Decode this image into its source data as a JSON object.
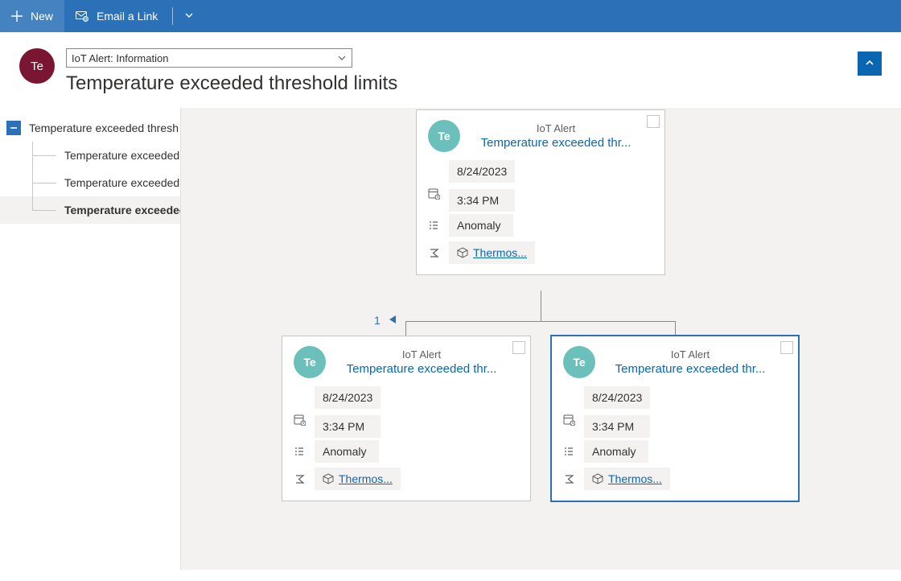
{
  "cmdbar": {
    "new_label": "New",
    "email_label": "Email a Link"
  },
  "header": {
    "avatar_initials": "Te",
    "form_selector": "IoT Alert: Information",
    "title": "Temperature exceeded threshold limits"
  },
  "tree": {
    "root": "Temperature exceeded thresh",
    "children": [
      "Temperature exceeded",
      "Temperature exceeded",
      "Temperature exceeded"
    ],
    "selected_index": 2
  },
  "pager": {
    "count": "1"
  },
  "card_common": {
    "avatar_initials": "Te",
    "type_label": "IoT Alert",
    "title": "Temperature exceeded thr...",
    "date": "8/24/2023",
    "time": "3:34 PM",
    "category": "Anomaly",
    "asset": "Thermos..."
  },
  "cards": [
    {
      "selected": false
    },
    {
      "selected": false
    },
    {
      "selected": true
    }
  ]
}
